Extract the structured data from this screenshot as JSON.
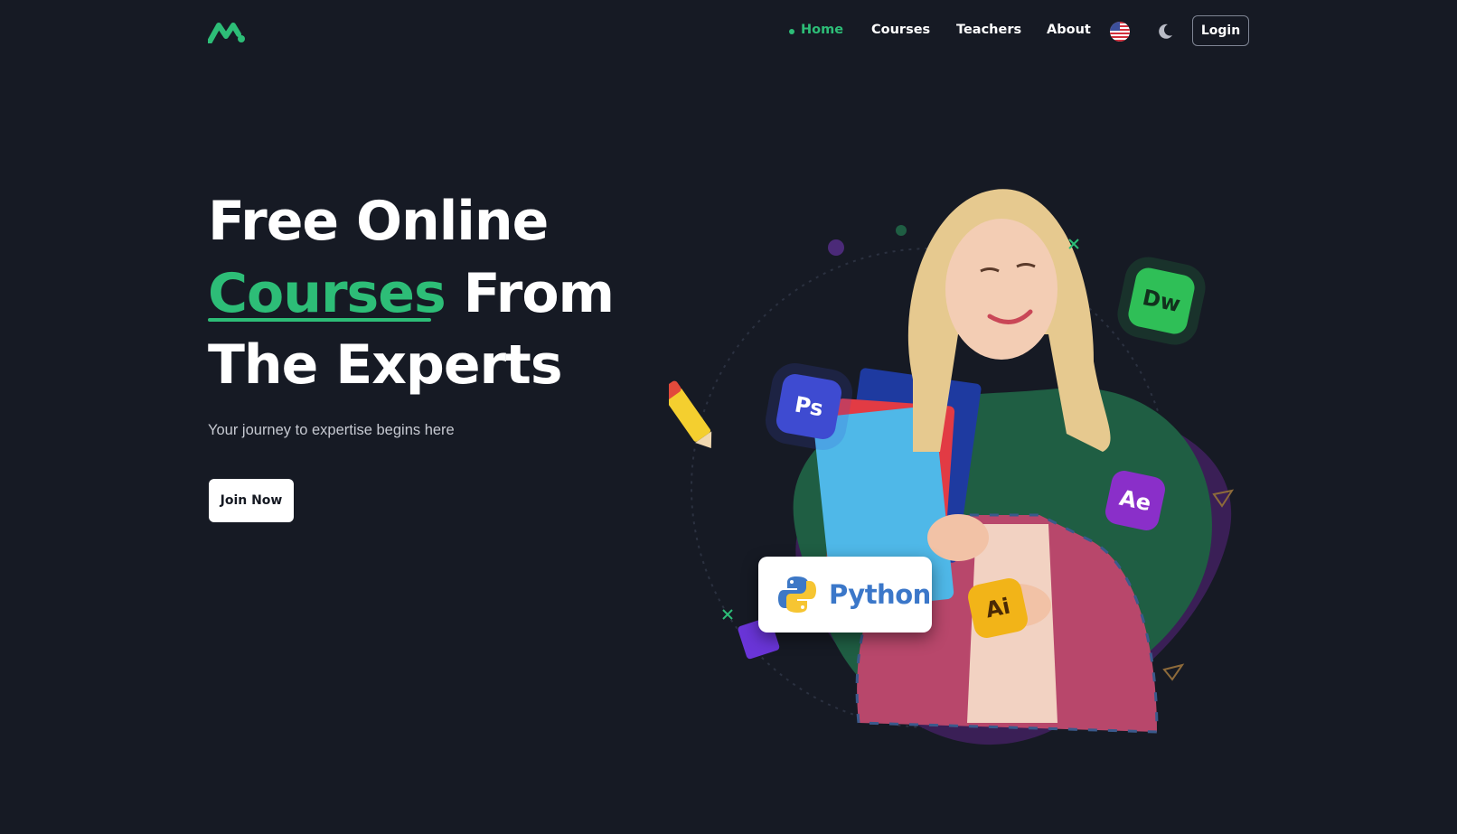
{
  "nav": {
    "items": [
      {
        "label": "Home"
      },
      {
        "label": "Courses"
      },
      {
        "label": "Teachers"
      },
      {
        "label": "About"
      }
    ],
    "language_icon": "us-flag-icon",
    "theme_icon": "moon-icon",
    "login_label": "Login"
  },
  "hero": {
    "line1": "Free Online",
    "highlight": "Courses",
    "line2_rest": "From",
    "line3": "The Experts",
    "subtitle": "Your journey to expertise begins here",
    "cta_label": "Join Now"
  },
  "illustration": {
    "python_label": "Python",
    "badges": [
      {
        "label": "Ps",
        "color": "#3e4bd1"
      },
      {
        "label": "Dw",
        "color": "#2fbf57"
      },
      {
        "label": "Ae",
        "color": "#8a2fc9"
      },
      {
        "label": "Ai",
        "color": "#f2b418"
      }
    ]
  },
  "colors": {
    "background": "#161a24",
    "accent": "#2dbd77"
  }
}
